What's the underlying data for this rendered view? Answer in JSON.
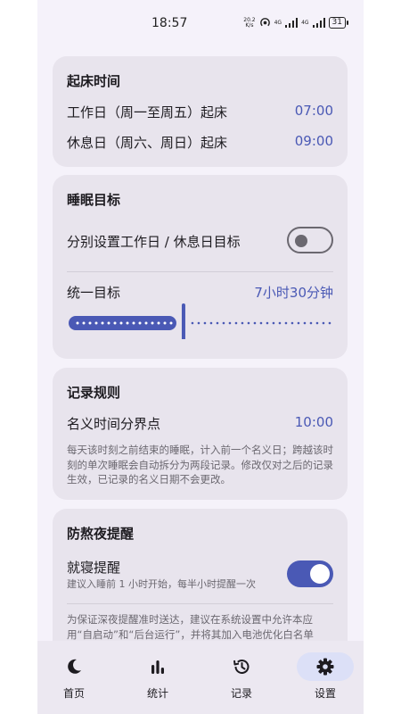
{
  "status_bar": {
    "time": "18:57",
    "net_speed_value": "20.2",
    "net_speed_unit": "K/s",
    "signal1_tag": "4G",
    "signal2_tag": "4G",
    "battery": "31"
  },
  "wake_time": {
    "title": "起床时间",
    "workday_label": "工作日（周一至周五）起床",
    "workday_value": "07:00",
    "restday_label": "休息日（周六、周日）起床",
    "restday_value": "09:00"
  },
  "sleep_goal": {
    "title": "睡眠目标",
    "separate_label": "分别设置工作日 / 休息日目标",
    "separate_enabled": false,
    "unified_label": "统一目标",
    "unified_value": "7小时30分钟",
    "slider_fraction": 0.43
  },
  "record_rules": {
    "title": "记录规则",
    "boundary_label": "名义时间分界点",
    "boundary_value": "10:00",
    "description": "每天该时刻之前结束的睡眠，计入前一个名义日；跨越该时刻的单次睡眠会自动拆分为两段记录。修改仅对之后的记录生效，已记录的名义日期不会更改。"
  },
  "anti_late": {
    "title": "防熬夜提醒",
    "reminder_label": "就寝提醒",
    "reminder_sub": "建议入睡前 1 小时开始，每半小时提醒一次",
    "reminder_enabled": true,
    "note": "为保证深夜提醒准时送达，建议在系统设置中允许本应用“自启动”和“后台运行”，并将其加入电池优化白名单"
  },
  "bottom_nav": {
    "items": [
      {
        "label": "首页",
        "icon": "moon-icon"
      },
      {
        "label": "统计",
        "icon": "bar-chart-icon"
      },
      {
        "label": "记录",
        "icon": "history-icon"
      },
      {
        "label": "设置",
        "icon": "gear-icon"
      }
    ],
    "active_index": 3
  },
  "colors": {
    "accent": "#4a59b5",
    "card_bg": "#e8e4ed",
    "page_bg": "#f5f2fa",
    "active_pill": "#dce0f7"
  }
}
